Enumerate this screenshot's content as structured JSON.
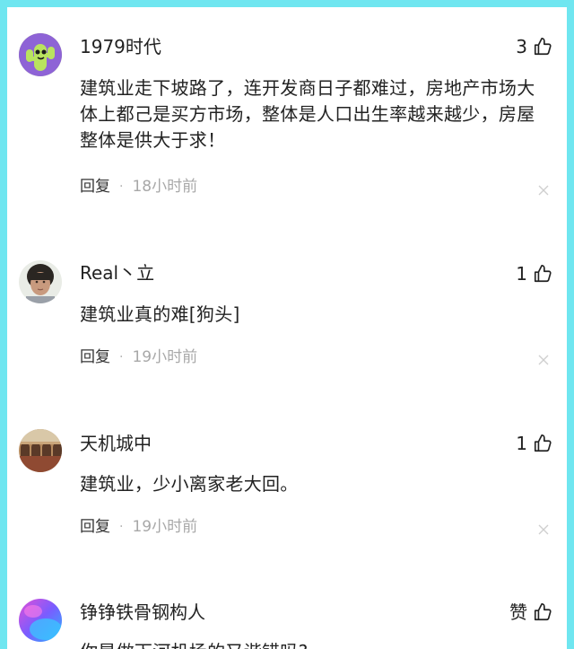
{
  "comments": [
    {
      "username": "1979时代",
      "likes": "3",
      "content": "建筑业走下坡路了，连开发商日子都难过，房地产市场大体上都己是买方市场，整体是人口出生率越来越少，房屋整体是供大于求！",
      "reply_label": "回复",
      "separator": "·",
      "time": "18小时前",
      "avatar_icon": "cactus-icon"
    },
    {
      "username": "Real丶立",
      "likes": "1",
      "content": "建筑业真的难[狗头]",
      "reply_label": "回复",
      "separator": "·",
      "time": "19小时前",
      "avatar_icon": "person-photo"
    },
    {
      "username": "天机城中",
      "likes": "1",
      "content": "建筑业，少小离家老大回。",
      "reply_label": "回复",
      "separator": "·",
      "time": "19小时前",
      "avatar_icon": "arches-photo"
    },
    {
      "username": "铮铮铁骨钢构人",
      "likes": "赞",
      "content": "你是做下河机场的又谐错吗?",
      "avatar_icon": "gradient-orb"
    }
  ],
  "colors": {
    "border": "#6fe6f0",
    "text": "#222222",
    "time": "#a8a8a8"
  }
}
